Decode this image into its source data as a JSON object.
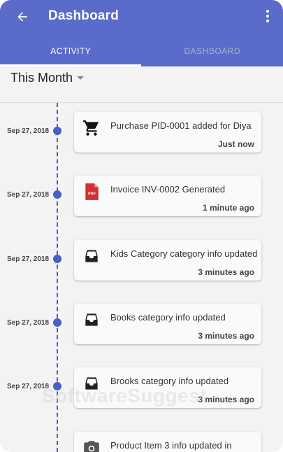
{
  "appbar": {
    "title": "Dashboard",
    "back_icon": "arrow-left-icon",
    "more_icon": "more-vertical-icon",
    "color": "#5a6bc9"
  },
  "tabs": [
    {
      "label": "ACTIVITY",
      "active": true
    },
    {
      "label": "DASHBOARD",
      "active": false
    }
  ],
  "filter": {
    "label": "This Month"
  },
  "timeline": [
    {
      "date": "Sep 27, 2018",
      "icon": "shopping-cart-icon",
      "text": "Purchase PID-0001 added for Diya",
      "time": "Just now"
    },
    {
      "date": "Sep 27, 2018",
      "icon": "pdf-file-icon",
      "text": "Invoice INV-0002 Generated",
      "time": "1 minute ago"
    },
    {
      "date": "Sep 27, 2018",
      "icon": "inbox-tray-icon",
      "text": "Kids Category category info updated",
      "time": "3 minutes ago"
    },
    {
      "date": "Sep 27, 2018",
      "icon": "inbox-tray-icon",
      "text": "Books category info updated",
      "time": "3 minutes ago"
    },
    {
      "date": "Sep 27, 2018",
      "icon": "inbox-tray-icon",
      "text": "Brooks category info updated",
      "time": "3 minutes ago"
    },
    {
      "date": "",
      "icon": "camera-icon",
      "text": "Product Item 3 info updated in",
      "time": ""
    }
  ],
  "watermark": "SoftwareSuggest"
}
